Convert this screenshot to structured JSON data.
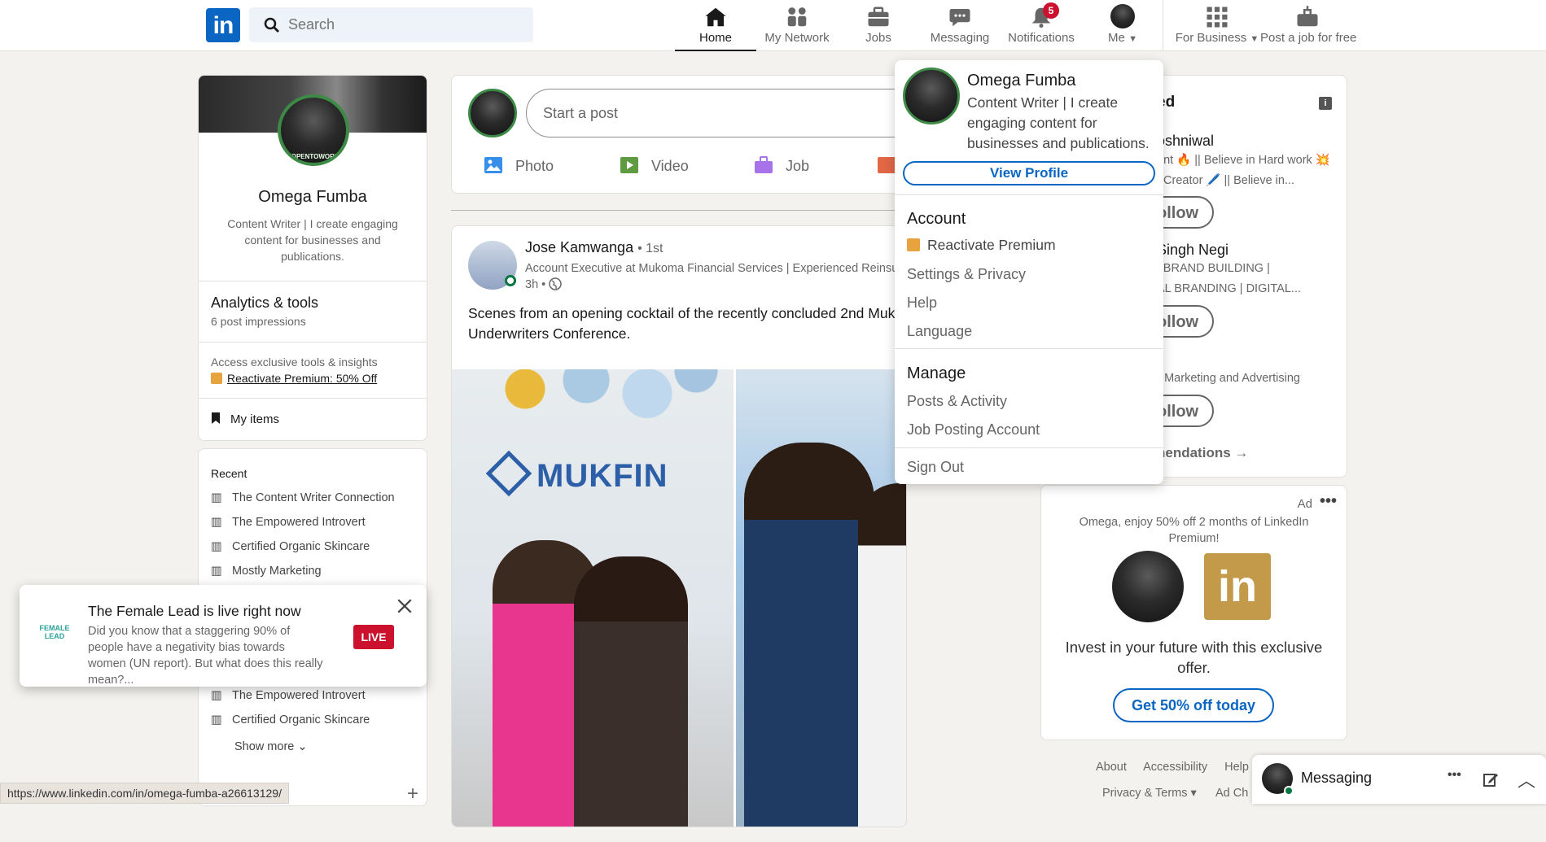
{
  "nav": {
    "search_placeholder": "Search",
    "items": [
      {
        "label": "Home"
      },
      {
        "label": "My Network"
      },
      {
        "label": "Jobs"
      },
      {
        "label": "Messaging"
      },
      {
        "label": "Notifications",
        "badge": "5"
      },
      {
        "label": "Me"
      },
      {
        "label": "For Business"
      },
      {
        "label": "Post a job for free"
      }
    ]
  },
  "profile": {
    "name": "Omega Fumba",
    "headline": "Content Writer | I create engaging content for businesses and publications.",
    "frame_text": "#OPENTOWORK",
    "analytics_title": "Analytics & tools",
    "analytics_sub": "6 post impressions",
    "premium_text": "Access exclusive tools & insights",
    "premium_link": "Reactivate Premium: 50% Off",
    "my_items": "My items"
  },
  "recent": {
    "title": "Recent",
    "items": [
      "The Content Writer Connection",
      "The Empowered Introvert",
      "Certified Organic Skincare",
      "Mostly Marketing"
    ],
    "items_lower": [
      "The Empowered Introvert",
      "Certified Organic Skincare"
    ],
    "show_more": "Show more"
  },
  "composer": {
    "placeholder": "Start a post",
    "actions": [
      "Photo",
      "Video",
      "Job"
    ]
  },
  "post": {
    "author": "Jose Kamwanga",
    "degree": "• 1st",
    "subtitle": "Account Executive at Mukoma Financial Services | Experienced Reinsu",
    "time": "3h •",
    "text": "Scenes from an opening cocktail of the recently concluded 2nd Muk Underwriters Conference.",
    "image_logo_text": "MUKFIN"
  },
  "me_menu": {
    "name": "Omega Fumba",
    "headline": "Content Writer | I create engaging content for businesses and publications.",
    "view_profile": "View Profile",
    "account_header": "Account",
    "account_items": [
      "Reactivate Premium",
      "Settings & Privacy",
      "Help",
      "Language"
    ],
    "manage_header": "Manage",
    "manage_items": [
      "Posts & Activity",
      "Job Posting Account"
    ],
    "sign_out": "Sign Out"
  },
  "suggestions": {
    "title_partial": "ed",
    "people": [
      {
        "name": "oshniwal",
        "line1": "ant 🔥 || Believe in Hard work 💥",
        "line2": "t Creator 🖊️ || Believe in...",
        "button": "ollow"
      },
      {
        "name": "Singh Negi",
        "line1": "| BRAND BUILDING |",
        "line2": "AL BRANDING | DIGITAL...",
        "button": "ollow"
      },
      {
        "name": "",
        "line1": "• Marketing and Advertising",
        "line2": "",
        "button": "ollow"
      }
    ],
    "footer_link": "nendations →"
  },
  "ad": {
    "label": "Ad",
    "text": "Omega, enjoy 50% off 2 months of LinkedIn Premium!",
    "tagline": "Invest in your future with this exclusive offer.",
    "cta": "Get 50% off today"
  },
  "footer": {
    "row1": [
      "About",
      "Accessibility",
      "Help"
    ],
    "row2": [
      "Privacy & Terms ▾",
      "Ad Ch"
    ]
  },
  "messaging": {
    "label": "Messaging"
  },
  "toast": {
    "logo_text": "FEMALE LEAD",
    "title": "The Female Lead is live right now",
    "body": "Did you know that a staggering 90% of people have a negativity bias towards women (UN report). But what does this really mean?...",
    "live": "LIVE"
  },
  "status_url": "https://www.linkedin.com/in/omega-fumba-a26613129/",
  "colors": {
    "brand": "#0a66c2",
    "badge": "#cb112d",
    "premium": "#e7a33e",
    "live": "#cb112d"
  },
  "icons": [
    "home-icon",
    "network-icon",
    "jobs-icon",
    "messaging-icon",
    "bell-icon",
    "grid-icon",
    "briefcase-plus-icon",
    "photo-icon",
    "video-icon",
    "job-icon",
    "bookmark-icon",
    "group-icon",
    "close-icon",
    "globe-icon",
    "info-icon",
    "more-icon",
    "compose-icon",
    "chevron-up-icon",
    "plus-icon"
  ]
}
